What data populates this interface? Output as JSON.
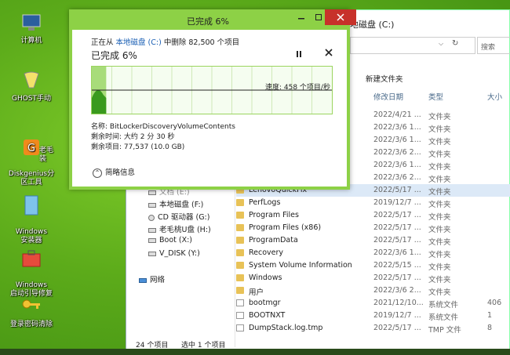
{
  "desktop": {
    "icons": [
      {
        "label": "计算机"
      },
      {
        "label": "GHOST手动"
      },
      {
        "label": "Diskgenius分\n区工具"
      },
      {
        "label": "老毛\n装"
      },
      {
        "label": "Windows\n安装器"
      },
      {
        "label": "Windows\n启动引导修复"
      },
      {
        "label": "登录密码清除"
      }
    ]
  },
  "explorer": {
    "title": "地磁盘 (C:)",
    "search_placeholder": "搜索",
    "toolbar": {
      "new_folder": "新建文件夹"
    },
    "columns": {
      "modified": "修改日期",
      "type": "类型",
      "size": "大小"
    },
    "nav": [
      {
        "label": "文档 (E:)"
      },
      {
        "label": "本地磁盘 (F:)"
      },
      {
        "label": "CD 驱动器 (G:)"
      },
      {
        "label": "老毛桃U盘 (H:)"
      },
      {
        "label": "Boot (X:)"
      },
      {
        "label": "V_DISK (Y:)"
      },
      {
        "label": "网络"
      }
    ],
    "rows_top": [
      {
        "date": "2022/4/21 ...",
        "type": "文件夹"
      },
      {
        "date": "2022/3/6 1...",
        "type": "文件夹"
      },
      {
        "date": "2022/3/6 1...",
        "type": "文件夹"
      },
      {
        "date": "2022/3/6 2...",
        "type": "文件夹"
      },
      {
        "date": "2022/3/6 1...",
        "type": "文件夹"
      },
      {
        "date": "2022/3/6 2...",
        "type": "文件夹"
      }
    ],
    "files": [
      {
        "name": "LenovoQuickFix",
        "date": "2022/5/17 ...",
        "type": "文件夹",
        "size": "",
        "kind": "folder"
      },
      {
        "name": "PerfLogs",
        "date": "2019/12/7 ...",
        "type": "文件夹",
        "size": "",
        "kind": "folder"
      },
      {
        "name": "Program Files",
        "date": "2022/5/17 ...",
        "type": "文件夹",
        "size": "",
        "kind": "folder"
      },
      {
        "name": "Program Files (x86)",
        "date": "2022/5/17 ...",
        "type": "文件夹",
        "size": "",
        "kind": "folder"
      },
      {
        "name": "ProgramData",
        "date": "2022/5/17 ...",
        "type": "文件夹",
        "size": "",
        "kind": "folder"
      },
      {
        "name": "Recovery",
        "date": "2022/3/6 1...",
        "type": "文件夹",
        "size": "",
        "kind": "folder"
      },
      {
        "name": "System Volume Information",
        "date": "2022/5/15 ...",
        "type": "文件夹",
        "size": "",
        "kind": "folder"
      },
      {
        "name": "Windows",
        "date": "2022/5/17 ...",
        "type": "文件夹",
        "size": "",
        "kind": "folder"
      },
      {
        "name": "用户",
        "date": "2022/3/6 2...",
        "type": "文件夹",
        "size": "",
        "kind": "folder"
      },
      {
        "name": "bootmgr",
        "date": "2021/12/10...",
        "type": "系统文件",
        "size": "406",
        "kind": "file"
      },
      {
        "name": "BOOTNXT",
        "date": "2019/12/7 ...",
        "type": "系统文件",
        "size": "1",
        "kind": "file"
      },
      {
        "name": "DumpStack.log.tmp",
        "date": "2022/5/17 ...",
        "type": "TMP 文件",
        "size": "8",
        "kind": "file"
      }
    ],
    "status": {
      "count": "24 个项目",
      "selected": "选中 1 个项目"
    }
  },
  "dialog": {
    "title": "已完成 6%",
    "line1_prefix": "正在从 ",
    "line1_link": "本地磁盘 (C:)",
    "line1_suffix": " 中删除 82,500 个项目",
    "percent_label": "已完成 6%",
    "speed": "速度: 458 个项目/秒",
    "name": "名称: BitLockerDiscoveryVolumeContents",
    "remaining_time": "剩余时间: 大约 2 分 30 秒",
    "remaining_items": "剩余项目: 77,537 (10.0 GB)",
    "less_details": "简略信息",
    "progress": 0.06,
    "accent": "#8dd146"
  }
}
